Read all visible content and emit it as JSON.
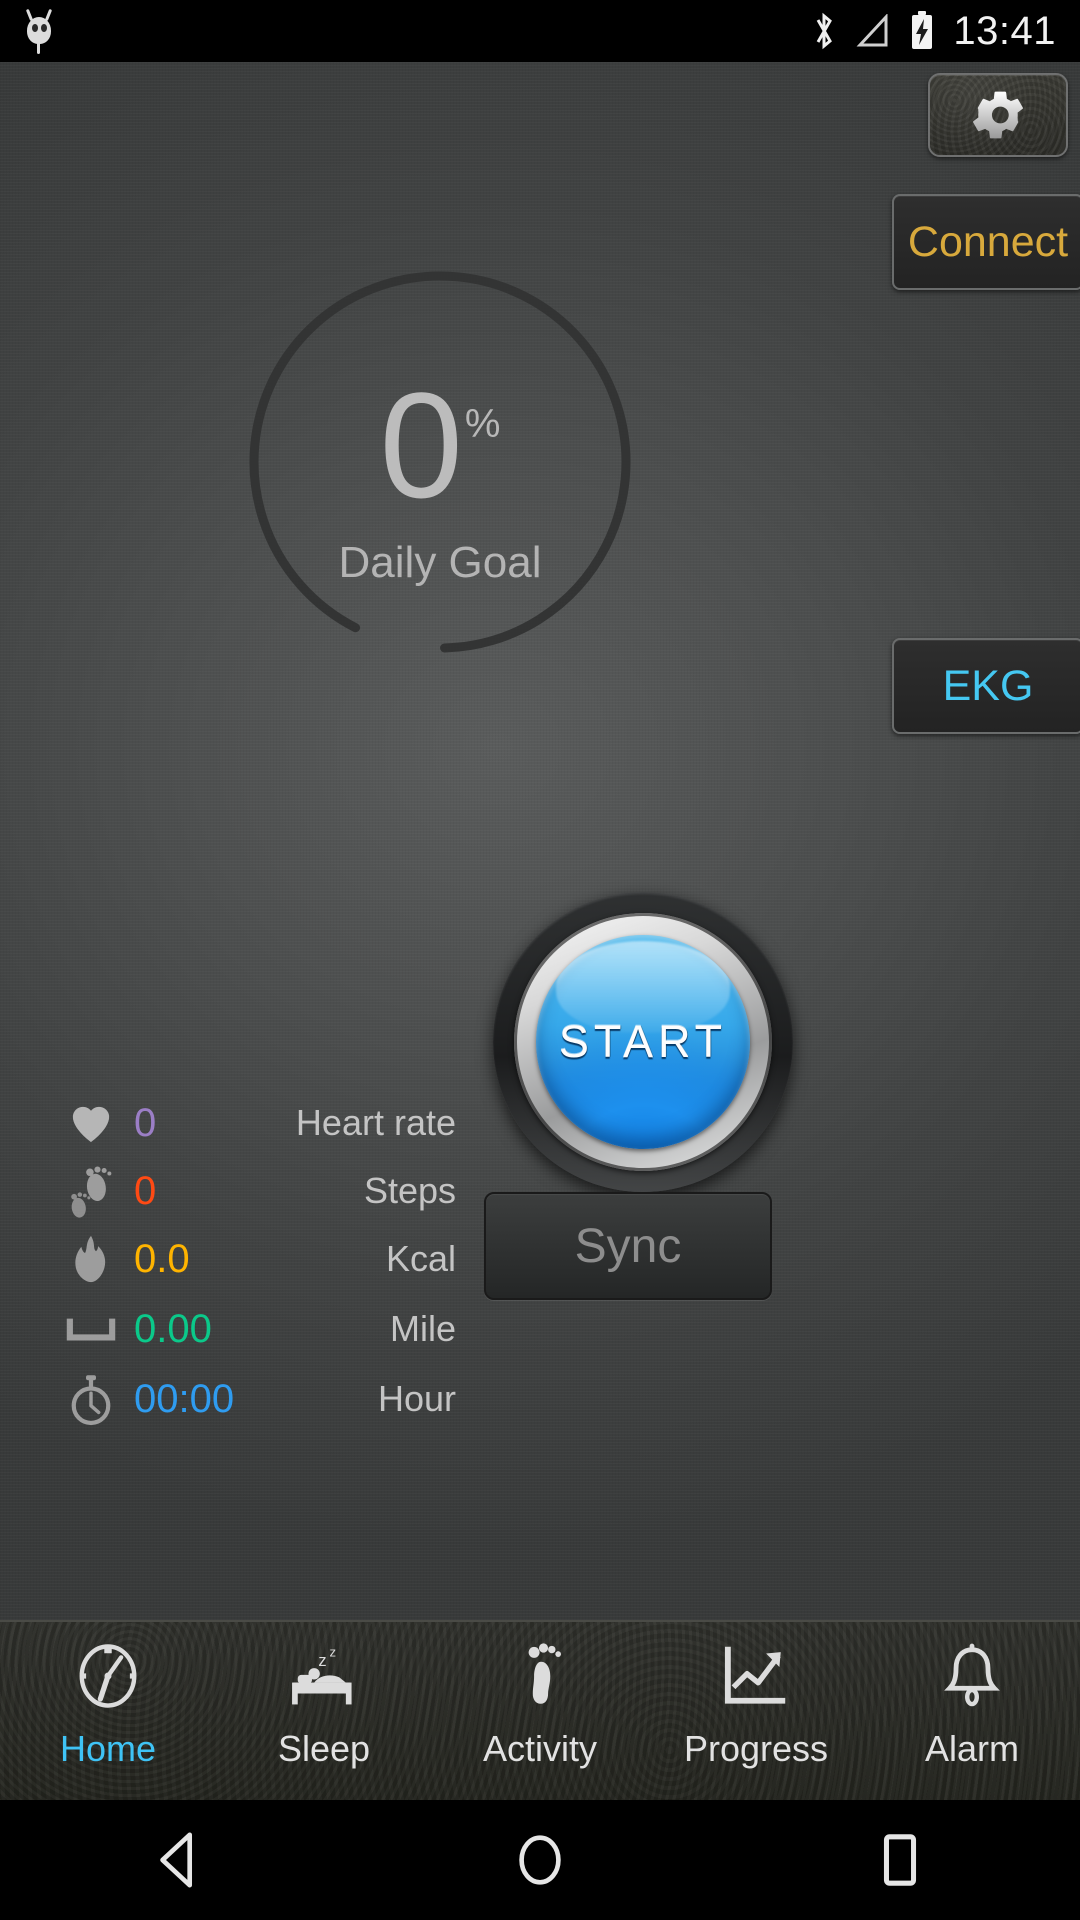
{
  "statusbar": {
    "time": "13:41",
    "icons": [
      "app-owl-icon",
      "bluetooth-icon",
      "signal-icon",
      "battery-charging-icon"
    ]
  },
  "header": {
    "settings_icon": "gear-icon",
    "connect_label": "Connect",
    "connect_color": "#d8a93c",
    "ekg_label": "EKG",
    "ekg_color": "#45c8f2"
  },
  "goal": {
    "value": "0",
    "unit": "%",
    "label": "Daily Goal",
    "percent": 0,
    "ring_color": "#333434"
  },
  "stats": [
    {
      "icon": "heart-icon",
      "value": "0",
      "name": "Heart rate",
      "color": "#9b7ec6"
    },
    {
      "icon": "footprints-icon",
      "value": "0",
      "name": "Steps",
      "color": "#ff4a14"
    },
    {
      "icon": "flame-icon",
      "value": "0.0",
      "name": "Kcal",
      "color": "#ffb400"
    },
    {
      "icon": "distance-icon",
      "value": "0.00",
      "name": "Mile",
      "color": "#0bc98a"
    },
    {
      "icon": "stopwatch-icon",
      "value": "00:00",
      "name": "Hour",
      "color": "#2f9cf0"
    }
  ],
  "actions": {
    "start_label": "START",
    "sync_label": "Sync"
  },
  "nav": {
    "active": "Home",
    "items": [
      {
        "label": "Home",
        "icon": "speedometer-icon"
      },
      {
        "label": "Sleep",
        "icon": "bed-sleep-icon"
      },
      {
        "label": "Activity",
        "icon": "footprint-icon"
      },
      {
        "label": "Progress",
        "icon": "chart-trend-icon"
      },
      {
        "label": "Alarm",
        "icon": "bell-icon"
      }
    ]
  },
  "softkeys": {
    "back": "back-triangle-icon",
    "home": "home-circle-icon",
    "recents": "recents-square-icon"
  }
}
